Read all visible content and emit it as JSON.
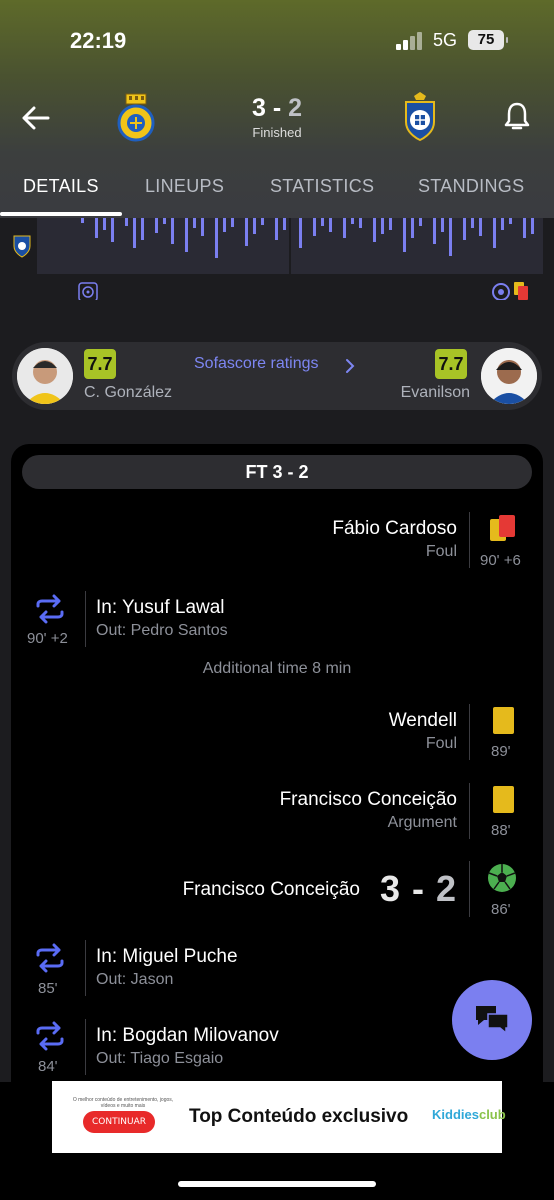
{
  "status_bar": {
    "time": "22:19",
    "network": "5G",
    "battery": "75"
  },
  "match": {
    "home_score": "3",
    "separator": " - ",
    "away_score": "2",
    "status": "Finished"
  },
  "tabs": [
    {
      "label": "DETAILS",
      "active": true
    },
    {
      "label": "LINEUPS",
      "active": false
    },
    {
      "label": "STATISTICS",
      "active": false
    },
    {
      "label": "STANDINGS",
      "active": false
    }
  ],
  "ratings": {
    "link_label": "Sofascore ratings",
    "home_player": {
      "name": "C. González",
      "rating": "7.7"
    },
    "away_player": {
      "name": "Evanilson",
      "rating": "7.7"
    }
  },
  "events": {
    "ft_label": "FT 3 - 2",
    "additional_time": "Additional time 8 min",
    "red_card_cardoso": {
      "player": "Fábio Cardoso",
      "reason": "Foul",
      "time": "90' +6"
    },
    "sub_lawal": {
      "in": "In: Yusuf Lawal",
      "out": "Out: Pedro Santos",
      "time": "90' +2"
    },
    "yellow_wendell": {
      "player": "Wendell",
      "reason": "Foul",
      "time": "89'"
    },
    "yellow_conceicao": {
      "player": "Francisco Conceição",
      "reason": "Argument",
      "time": "88'"
    },
    "goal_conceicao": {
      "player": "Francisco Conceição",
      "home_score": "3",
      "separator": " - ",
      "away_score": "2",
      "time": "86'"
    },
    "sub_puche": {
      "in": "In: Miguel Puche",
      "out": "Out: Jason",
      "time": "85'"
    },
    "sub_milovanov": {
      "in": "In: Bogdan Milovanov",
      "out": "Out: Tiago Esgaio",
      "time": "84'"
    }
  },
  "ad": {
    "small_text": "O melhor conteúdo de entretenimento, jogos, vídeos e muito mais",
    "button": "CONTINUAR",
    "title": "Top Conteúdo exclusivo",
    "logo_part1": "Kiddies",
    "logo_part2": "club"
  },
  "colors": {
    "accent": "#7b7ff0",
    "rating_badge": "#a8c326",
    "red_card": "#e53935",
    "yellow_card": "#e5ba1c",
    "goal_ball": "#4caf50"
  },
  "icons": [
    "back-arrow-icon",
    "bell-icon",
    "substitution-icon",
    "goal-ball-icon",
    "red-card-icon",
    "yellow-card-icon",
    "chat-icon",
    "chevron-right-icon"
  ]
}
